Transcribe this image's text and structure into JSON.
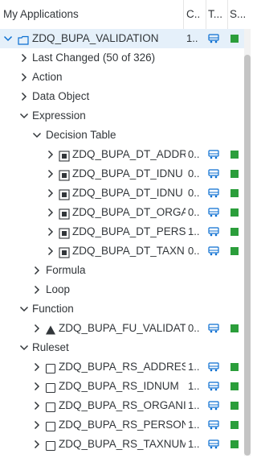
{
  "header": {
    "col_name": "My Applications",
    "col_c": "C..",
    "col_t": "T...",
    "col_s": "S..."
  },
  "colors": {
    "status_active": "#2b9e3b",
    "selected_bg": "#e5f0fa",
    "accent_icon": "#0a6ed1"
  },
  "tree": {
    "root": {
      "label": "ZDQ_BUPA_VALIDATION",
      "c": "1..",
      "icon": "application-icon",
      "status": "active"
    },
    "last_changed": "Last Changed (50 of 326)",
    "action": "Action",
    "data_object": "Data Object",
    "expression": "Expression",
    "decision_table": "Decision Table",
    "decision_tables": [
      {
        "label": "ZDQ_BUPA_DT_ADDR",
        "c": "0.."
      },
      {
        "label": "ZDQ_BUPA_DT_IDNU",
        "c": "0.."
      },
      {
        "label": "ZDQ_BUPA_DT_IDNU",
        "c": "0.."
      },
      {
        "label": "ZDQ_BUPA_DT_ORGA",
        "c": "0.."
      },
      {
        "label": "ZDQ_BUPA_DT_PERS",
        "c": "1.."
      },
      {
        "label": "ZDQ_BUPA_DT_TAXN",
        "c": "0.."
      }
    ],
    "formula": "Formula",
    "loop": "Loop",
    "function": "Function",
    "functions": [
      {
        "label": "ZDQ_BUPA_FU_VALIDAT",
        "c": "0.."
      }
    ],
    "ruleset": "Ruleset",
    "rulesets": [
      {
        "label": "ZDQ_BUPA_RS_ADDRES",
        "c": "1.."
      },
      {
        "label": "ZDQ_BUPA_RS_IDNUM",
        "c": "1.."
      },
      {
        "label": "ZDQ_BUPA_RS_ORGANI",
        "c": "1.."
      },
      {
        "label": "ZDQ_BUPA_RS_PERSON",
        "c": "1.."
      },
      {
        "label": "ZDQ_BUPA_RS_TAXNUM",
        "c": "1.."
      }
    ]
  }
}
